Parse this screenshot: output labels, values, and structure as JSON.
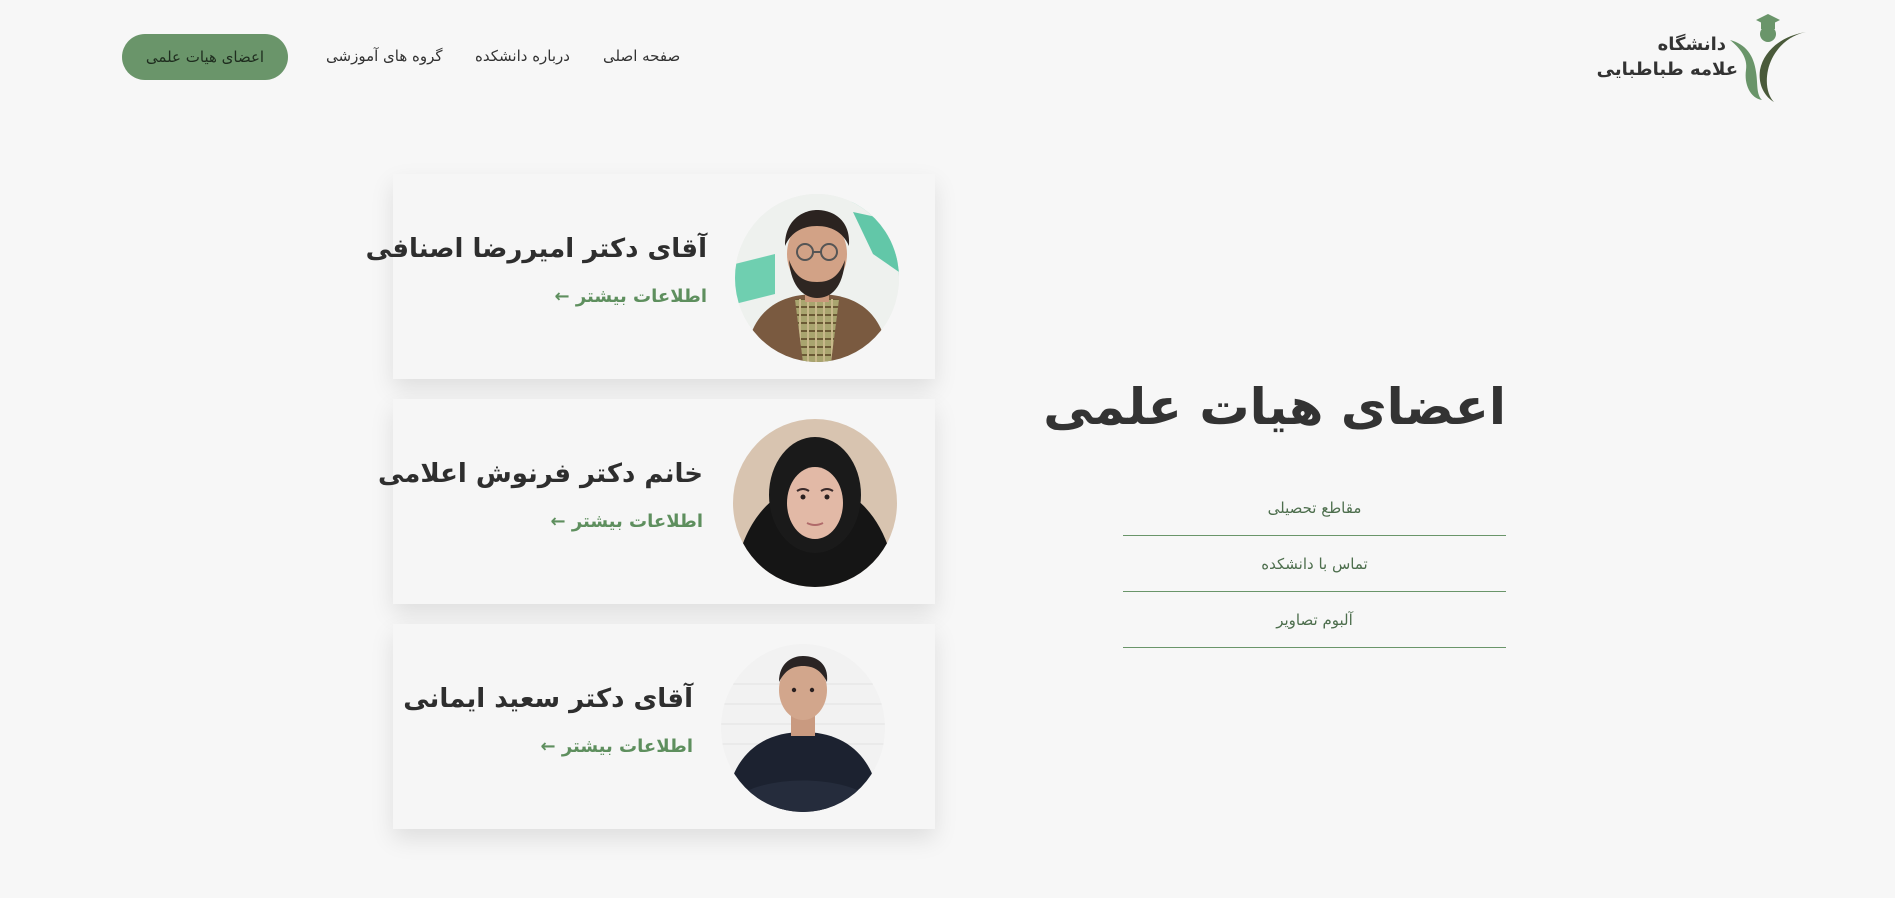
{
  "header": {
    "logo": {
      "line1": "دانشگاه",
      "line2": "علامه طباطبایی"
    },
    "nav": {
      "active_button": "اعضای هیات علمی",
      "links": [
        "گروه های آموزشی",
        "درباره دانشکده",
        "صفحه اصلی"
      ]
    }
  },
  "members": [
    {
      "name": "آقای دکتر امیررضا اصنافی",
      "more": "اطلاعات بیشتر ←"
    },
    {
      "name": "خانم دکتر فرنوش اعلامی",
      "more": "اطلاعات بیشتر ←"
    },
    {
      "name": "آقای دکتر سعید ایمانی",
      "more": "اطلاعات بیشتر ←"
    }
  ],
  "sidebar": {
    "title": "اعضای هیات علمی",
    "items": [
      "مقاطع تحصیلی",
      "تماس با دانشکده",
      "آلبوم تصاویر"
    ]
  },
  "colors": {
    "accent": "#6a956a",
    "background": "#f7f7f7"
  }
}
